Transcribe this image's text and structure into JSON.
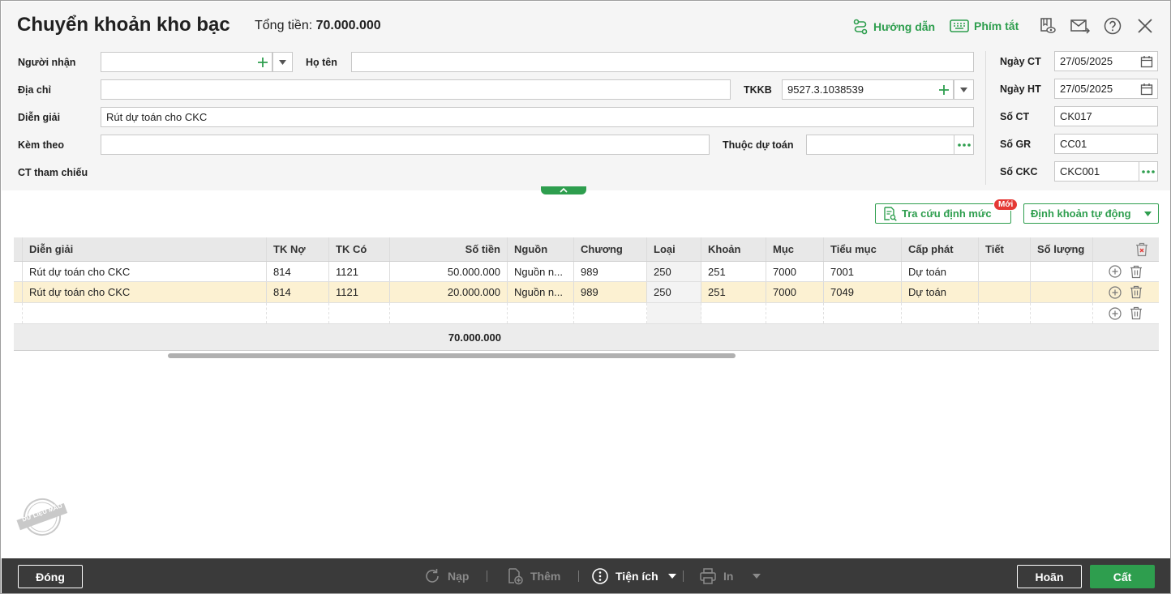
{
  "header": {
    "title": "Chuyển khoản kho bạc",
    "total_label": "Tổng tiền:",
    "total_value": "70.000.000",
    "guide_label": "Hướng dẫn",
    "shortcut_label": "Phím tắt"
  },
  "form": {
    "recipient_label": "Người nhận",
    "recipient_value": "",
    "fullname_label": "Họ tên",
    "fullname_value": "",
    "address_label": "Địa chỉ",
    "address_value": "",
    "tkkb_label": "TKKB",
    "tkkb_value": "9527.3.1038539",
    "description_label": "Diễn giải",
    "description_value": "Rút dự toán cho CKC",
    "attach_label": "Kèm theo",
    "attach_value": "",
    "budget_label": "Thuộc dự toán",
    "budget_value": "",
    "ref_label": "CT tham chiếu"
  },
  "side": {
    "date_ct_label": "Ngày CT",
    "date_ct_value": "27/05/2025",
    "date_ht_label": "Ngày HT",
    "date_ht_value": "27/05/2025",
    "so_ct_label": "Số CT",
    "so_ct_value": "CK017",
    "so_gr_label": "Số GR",
    "so_gr_value": "CC01",
    "so_ckc_label": "Số CKC",
    "so_ckc_value": "CKC001"
  },
  "actions": {
    "lookup_label": "Tra cứu định mức",
    "new_badge": "Mới",
    "auto_label": "Định khoản tự động"
  },
  "table": {
    "columns": [
      "Diễn giải",
      "TK Nợ",
      "TK Có",
      "Số tiền",
      "Nguồn",
      "Chương",
      "Loại",
      "Khoản",
      "Mục",
      "Tiểu mục",
      "Cấp phát",
      "Tiết",
      "Số lượng"
    ],
    "rows": [
      [
        "Rút dự toán cho CKC",
        "814",
        "1121",
        "50.000.000",
        "Nguồn n...",
        "989",
        "250",
        "251",
        "7000",
        "7001",
        "Dự toán",
        "",
        ""
      ],
      [
        "Rút dự toán cho CKC",
        "814",
        "1121",
        "20.000.000",
        "Nguồn n...",
        "989",
        "250",
        "251",
        "7000",
        "7049",
        "Dự toán",
        "",
        ""
      ]
    ],
    "total": "70.000.000"
  },
  "stamp_text": "DỮ LIỆU MẪU",
  "footer": {
    "close_label": "Đóng",
    "reload_label": "Nạp",
    "add_label": "Thêm",
    "utility_label": "Tiện ích",
    "print_label": "In",
    "cancel_label": "Hoãn",
    "save_label": "Cất"
  },
  "colors": {
    "accent": "#2e9e4e",
    "selected_row": "#fcf1d2",
    "footer_bg": "#3a3a3a",
    "badge": "#e53935"
  }
}
